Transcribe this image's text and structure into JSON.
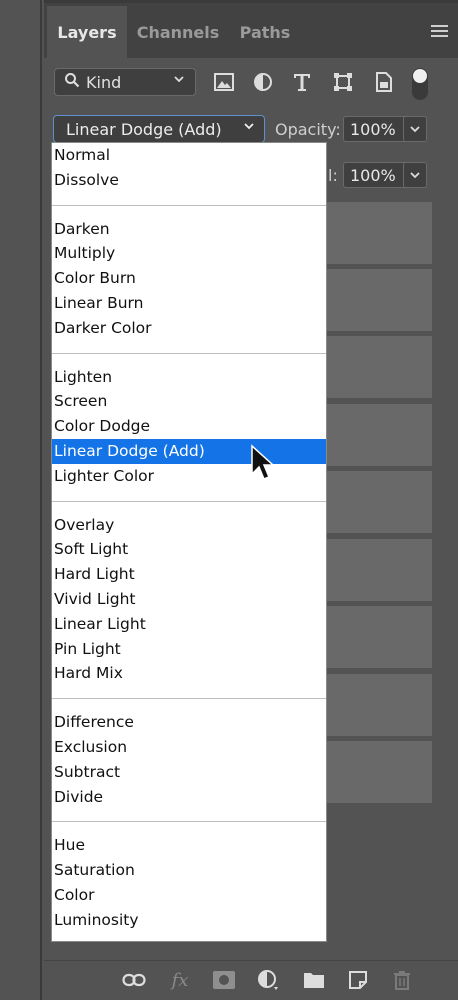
{
  "tabs": [
    {
      "label": "Layers",
      "active": true
    },
    {
      "label": "Channels",
      "active": false
    },
    {
      "label": "Paths",
      "active": false
    }
  ],
  "filter": {
    "kind_label": "Kind",
    "icons": [
      "image-filter-icon",
      "adjustment-filter-icon",
      "type-filter-icon",
      "shape-filter-icon",
      "smart-object-filter-icon"
    ]
  },
  "blend": {
    "current": "Linear Dodge (Add)",
    "opacity_label": "Opacity:",
    "opacity_value": "100%",
    "fill_fragment": "l:",
    "fill_value": "100%"
  },
  "menu": {
    "selected": "Linear Dodge (Add)",
    "groups": [
      [
        "Normal",
        "Dissolve"
      ],
      [
        "Darken",
        "Multiply",
        "Color Burn",
        "Linear Burn",
        "Darker Color"
      ],
      [
        "Lighten",
        "Screen",
        "Color Dodge",
        "Linear Dodge (Add)",
        "Lighter Color"
      ],
      [
        "Overlay",
        "Soft Light",
        "Hard Light",
        "Vivid Light",
        "Linear Light",
        "Pin Light",
        "Hard Mix"
      ],
      [
        "Difference",
        "Exclusion",
        "Subtract",
        "Divide"
      ],
      [
        "Hue",
        "Saturation",
        "Color",
        "Luminosity"
      ]
    ]
  },
  "footer_icons": [
    "link-layers-icon",
    "fx-icon",
    "mask-icon",
    "adjustment-layer-icon",
    "folder-icon",
    "new-layer-icon",
    "trash-icon"
  ],
  "colors": {
    "panel_bg": "#535353",
    "highlight": "#1473e6",
    "menu_bg": "#ffffff"
  }
}
